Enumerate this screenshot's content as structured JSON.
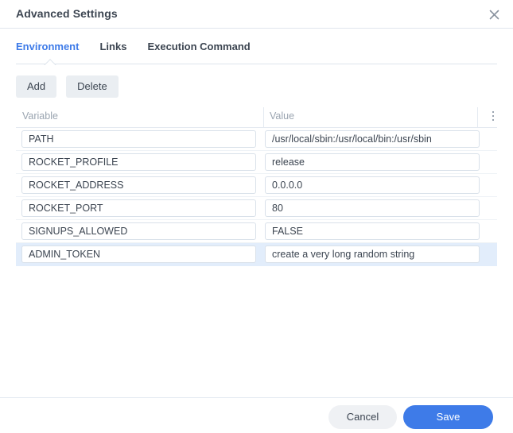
{
  "window": {
    "title": "Advanced Settings",
    "close_icon": "close-icon"
  },
  "tabs": [
    {
      "label": "Environment",
      "active": true
    },
    {
      "label": "Links",
      "active": false
    },
    {
      "label": "Execution Command",
      "active": false
    }
  ],
  "toolbar": {
    "add_label": "Add",
    "delete_label": "Delete"
  },
  "table": {
    "columns": [
      "Variable",
      "Value"
    ],
    "column_menu_icon": "kebab-menu-icon",
    "rows": [
      {
        "variable": "PATH",
        "value": "/usr/local/sbin:/usr/local/bin:/usr/sbin",
        "selected": false
      },
      {
        "variable": "ROCKET_PROFILE",
        "value": "release",
        "selected": false
      },
      {
        "variable": "ROCKET_ADDRESS",
        "value": "0.0.0.0",
        "selected": false
      },
      {
        "variable": "ROCKET_PORT",
        "value": "80",
        "selected": false
      },
      {
        "variable": "SIGNUPS_ALLOWED",
        "value": "FALSE",
        "selected": false
      },
      {
        "variable": "ADMIN_TOKEN",
        "value": "create a very long random string",
        "selected": true
      }
    ]
  },
  "footer": {
    "cancel_label": "Cancel",
    "save_label": "Save"
  },
  "colors": {
    "accent": "#3e7be8",
    "selected_row": "#e2edfb",
    "text": "#3c4551",
    "muted": "#9aa4b0",
    "border": "#e4eaf1",
    "toolbar_button": "#eaeef2"
  }
}
